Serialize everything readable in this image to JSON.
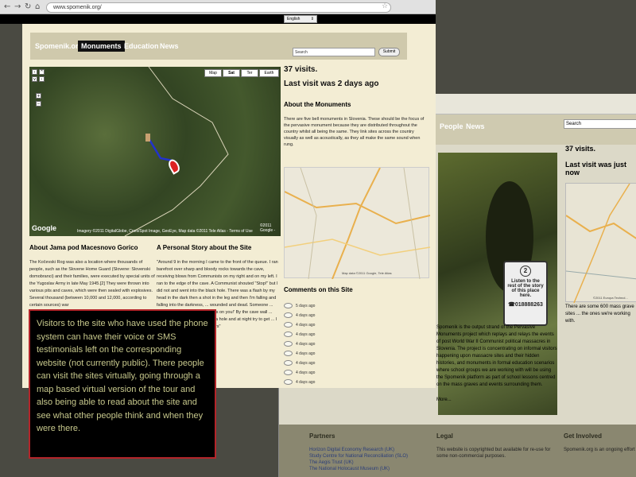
{
  "browser": {
    "url": "www.spomenik.org/",
    "back_icon": "arrow-left-icon",
    "forward_icon": "arrow-right-icon",
    "reload_icon": "reload-icon",
    "home_icon": "home-icon",
    "star_icon": "star-icon"
  },
  "language_select": {
    "value": "English"
  },
  "nav": {
    "items": [
      "Spomenik.org",
      "Monuments",
      "Education",
      "News"
    ],
    "active": "Monuments",
    "search_placeholder": "Search",
    "submit_label": "Submit"
  },
  "map": {
    "types": [
      "Map",
      "Sat",
      "Ter",
      "Earth"
    ],
    "active_type": "Sat",
    "logo": "Google",
    "copyright": "©2011 Google -",
    "imagery_credit": "Imagery ©2011 DigitalGlobe, Cnes/Spot Image, GeoEye, Map data ©2011 Tele Atlas - Terms of Use"
  },
  "stats": {
    "visits": "37 visits.",
    "last_visit": "Last visit was 2 days ago"
  },
  "about_monuments": {
    "title": "About the Monuments",
    "text": "There are five bell monuments in Slovenia. These should be the focus of the pervasive monument because they are distributed throughout the country whilst all being the same. They link sites across the country visually as well as acoustically, as they all make the same sound when rung."
  },
  "minimap": {
    "credit": "Map data ©2011 Google, Tele Atlas"
  },
  "comments": {
    "title": "Comments on this Site",
    "items": [
      "5 days ago",
      "4 days ago",
      "4 days ago",
      "4 days ago",
      "4 days ago",
      "4 days ago",
      "4 days ago",
      "4 days ago",
      "4 days ago"
    ]
  },
  "about_site": {
    "title": "About Jama pod Macesnovo Gorico",
    "text": "The Kočevski Rog was also a location where thousands of people, such as the Slovene Home Guard (Slovene: Slovenski domobranci) and their families, were executed by special units of the Yugoslav Army in late May 1945.[2] They were thrown into various pits and caves, which were then sealed with explosives. Several thousand (between 10,000 and 12,000, according to certain sources) war"
  },
  "personal_story": {
    "title": "A Personal Story about the Site",
    "text": "\"Around 9 in the morning I came to the front of the queue. I ran barefoot over sharp and bloody rocks towards the cave, receiving blows from Communists on my right and on my left. I ran to the edge of the cave. A Communist shouted \"Stop!\" but I did not and went into the black hole. There was a flash by my head in the dark then a shot in the leg and then I'm falling and falling into the darkness, ... wounded and dead. Someone ... sides 'Get out of the way ... falls on you!' By the cave wall ... who when he when noticed ... a hole and at night try to get ... I was, was a massive Karst ... ers\""
  },
  "caption": {
    "text": "Visitors to the site who have used the phone system can have their voice or SMS testimonials left on the corresponding website (not currently public). There people can visit the sites virtually, going through a map based virtual version of the tour and also being able to read about the site and see what other people think and when they were there."
  },
  "back_window": {
    "nav_items": [
      "People",
      "News"
    ],
    "search_placeholder": "Search",
    "visits": "37 visits.",
    "last_visit": "Last visit was just now",
    "sign_number": "2",
    "sign_text": "Listen to the rest of the story of this place here.",
    "sign_phone": "018888263",
    "graves_text": "There are some 600 mass grave sites ... the ones we're working with.",
    "para": "Spomenik is the output strand of the Pervasive Monuments project which replays and relays the events of post World War II Communist political massacres in Slovenia. The project is concentrating on informal visitors happening upon massacre sites and their hidden histories, and monuments in formal education scenarios where school groups we are working with will be using the Spomenik platform as part of school lessons centred on the mass graves and events surrounding them.",
    "more": "More...",
    "minimap_credit": "©2011 Europa Technol...",
    "footer": {
      "partners_title": "Partners",
      "partners": [
        "Horizon Digital Economy Research (UK)",
        "Study Centre for National Reconciliation (SLO)",
        "The Aegis Trust (UK)",
        "The National Holocaust Museum (UK)"
      ],
      "legal_title": "Legal",
      "legal_text": "This website is copyrighted but available for re-use for some non-commercial purposes.",
      "involved_title": "Get Involved",
      "involved_text": "Spomenik.org is an ongoing effort ... Get in touch or read more to find o..."
    }
  }
}
